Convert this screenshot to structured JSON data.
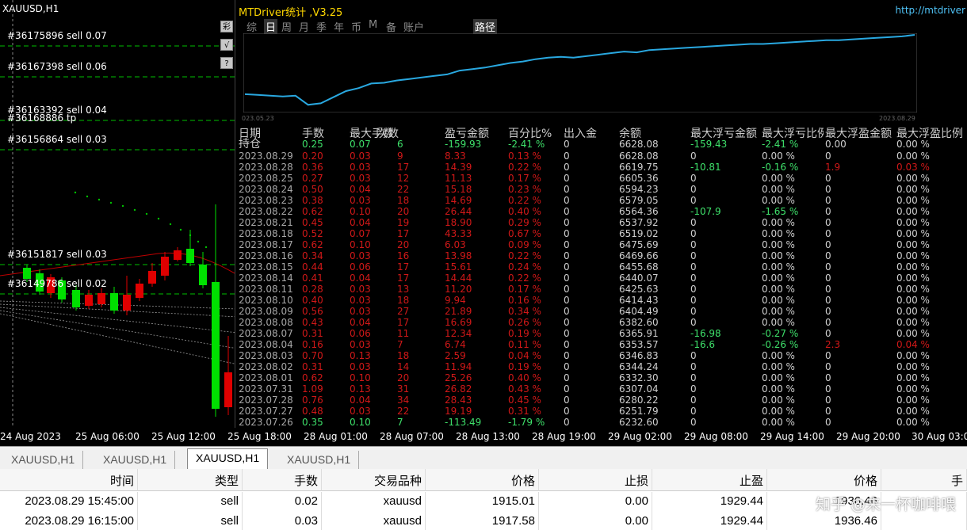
{
  "chart": {
    "symbol": "XAUUSD,H1",
    "orders": [
      {
        "label": "#36175896 sell 0.07"
      },
      {
        "label": "#36167398 sell 0.06"
      },
      {
        "label": "#36163392 sell 0.04"
      },
      {
        "label": "#36168886 tp"
      },
      {
        "label": "#36156864 sell 0.03"
      },
      {
        "label": "#36151817 sell 0.03"
      },
      {
        "label": "#36149786 sell 0.02"
      }
    ],
    "side_buttons": [
      "彩",
      "√",
      "?"
    ],
    "x_ticks": [
      "24 Aug 2023",
      "25 Aug 06:00",
      "25 Aug 12:00",
      "25 Aug 18:00",
      "28 Aug 01:00",
      "28 Aug 07:00",
      "28 Aug 13:00",
      "28 Aug 19:00",
      "29 Aug 02:00",
      "29 Aug 08:00",
      "29 Aug 14:00",
      "29 Aug 20:00",
      "30 Aug 03:00"
    ],
    "colors": {
      "bull": "#00e000",
      "bear": "#e00000",
      "dots": "#00c000",
      "ma": "#c00000"
    }
  },
  "panel": {
    "title": "MTDriver统计 ,V3.25",
    "url": "http://mtdriver",
    "tabs": [
      "综",
      "日",
      "周",
      "月",
      "季",
      "年",
      "币",
      "M",
      "备",
      "账户"
    ],
    "active_tab": "日",
    "route_label": "路径",
    "equity_curve": {
      "start_label": "023.05.23",
      "end_label": "2023.08.29",
      "color": "#29a8e0",
      "values": [
        0.22,
        0.21,
        0.2,
        0.19,
        0.2,
        0.08,
        0.1,
        0.18,
        0.26,
        0.3,
        0.36,
        0.37,
        0.4,
        0.42,
        0.44,
        0.46,
        0.48,
        0.53,
        0.55,
        0.57,
        0.6,
        0.63,
        0.65,
        0.68,
        0.7,
        0.71,
        0.7,
        0.72,
        0.74,
        0.76,
        0.78,
        0.77,
        0.8,
        0.81,
        0.82,
        0.83,
        0.84,
        0.85,
        0.86,
        0.87,
        0.88,
        0.88,
        0.89,
        0.9,
        0.91,
        0.92,
        0.93,
        0.93,
        0.94,
        0.95,
        0.96,
        0.97,
        0.98,
        1.0
      ]
    },
    "headers": [
      "日期",
      "手数",
      "最大手数",
      "次数",
      "盈亏金额",
      "百分比%",
      "出入金",
      "余额",
      "最大浮亏金额",
      "最大浮亏比例",
      "最大浮盈金额",
      "最大浮盈比例"
    ],
    "summary": {
      "label": "持仓",
      "lots": "0.25",
      "max_lots": "0.07",
      "count": "6",
      "pnl": "-159.93",
      "pct": "-2.41 %",
      "flow": "0",
      "balance": "6628.08",
      "max_float_loss": "-159.43",
      "max_float_loss_pct": "-2.41 %",
      "max_float_profit": "0.00",
      "max_float_profit_pct": "0.00 %"
    },
    "rows": [
      {
        "date": "2023.08.29",
        "lots": "0.20",
        "max_lots": "0.03",
        "count": "9",
        "pnl": "8.33",
        "pct": "0.13 %",
        "flow": "0",
        "balance": "6628.08",
        "mfl": "0",
        "mflp": "0.00 %",
        "mfp": "0",
        "mfpp": "0.00 %"
      },
      {
        "date": "2023.08.28",
        "lots": "0.36",
        "max_lots": "0.03",
        "count": "17",
        "pnl": "14.39",
        "pct": "0.22 %",
        "flow": "0",
        "balance": "6619.75",
        "mfl": "-10.81",
        "mflp": "-0.16 %",
        "mfp": "1.9",
        "mfpp": "0.03 %"
      },
      {
        "date": "2023.08.25",
        "lots": "0.27",
        "max_lots": "0.03",
        "count": "12",
        "pnl": "11.13",
        "pct": "0.17 %",
        "flow": "0",
        "balance": "6605.36",
        "mfl": "0",
        "mflp": "0.00 %",
        "mfp": "0",
        "mfpp": "0.00 %"
      },
      {
        "date": "2023.08.24",
        "lots": "0.50",
        "max_lots": "0.04",
        "count": "22",
        "pnl": "15.18",
        "pct": "0.23 %",
        "flow": "0",
        "balance": "6594.23",
        "mfl": "0",
        "mflp": "0.00 %",
        "mfp": "0",
        "mfpp": "0.00 %"
      },
      {
        "date": "2023.08.23",
        "lots": "0.38",
        "max_lots": "0.03",
        "count": "18",
        "pnl": "14.69",
        "pct": "0.22 %",
        "flow": "0",
        "balance": "6579.05",
        "mfl": "0",
        "mflp": "0.00 %",
        "mfp": "0",
        "mfpp": "0.00 %"
      },
      {
        "date": "2023.08.22",
        "lots": "0.62",
        "max_lots": "0.10",
        "count": "20",
        "pnl": "26.44",
        "pct": "0.40 %",
        "flow": "0",
        "balance": "6564.36",
        "mfl": "-107.9",
        "mflp": "-1.65 %",
        "mfp": "0",
        "mfpp": "0.00 %"
      },
      {
        "date": "2023.08.21",
        "lots": "0.45",
        "max_lots": "0.04",
        "count": "19",
        "pnl": "18.90",
        "pct": "0.29 %",
        "flow": "0",
        "balance": "6537.92",
        "mfl": "0",
        "mflp": "0.00 %",
        "mfp": "0",
        "mfpp": "0.00 %"
      },
      {
        "date": "2023.08.18",
        "lots": "0.52",
        "max_lots": "0.07",
        "count": "17",
        "pnl": "43.33",
        "pct": "0.67 %",
        "flow": "0",
        "balance": "6519.02",
        "mfl": "0",
        "mflp": "0.00 %",
        "mfp": "0",
        "mfpp": "0.00 %"
      },
      {
        "date": "2023.08.17",
        "lots": "0.62",
        "max_lots": "0.10",
        "count": "20",
        "pnl": "6.03",
        "pct": "0.09 %",
        "flow": "0",
        "balance": "6475.69",
        "mfl": "0",
        "mflp": "0.00 %",
        "mfp": "0",
        "mfpp": "0.00 %"
      },
      {
        "date": "2023.08.16",
        "lots": "0.34",
        "max_lots": "0.03",
        "count": "16",
        "pnl": "13.98",
        "pct": "0.22 %",
        "flow": "0",
        "balance": "6469.66",
        "mfl": "0",
        "mflp": "0.00 %",
        "mfp": "0",
        "mfpp": "0.00 %"
      },
      {
        "date": "2023.08.15",
        "lots": "0.44",
        "max_lots": "0.06",
        "count": "17",
        "pnl": "15.61",
        "pct": "0.24 %",
        "flow": "0",
        "balance": "6455.68",
        "mfl": "0",
        "mflp": "0.00 %",
        "mfp": "0",
        "mfpp": "0.00 %"
      },
      {
        "date": "2023.08.14",
        "lots": "0.41",
        "max_lots": "0.04",
        "count": "17",
        "pnl": "14.44",
        "pct": "0.22 %",
        "flow": "0",
        "balance": "6440.07",
        "mfl": "0",
        "mflp": "0.00 %",
        "mfp": "0",
        "mfpp": "0.00 %"
      },
      {
        "date": "2023.08.11",
        "lots": "0.28",
        "max_lots": "0.03",
        "count": "13",
        "pnl": "11.20",
        "pct": "0.17 %",
        "flow": "0",
        "balance": "6425.63",
        "mfl": "0",
        "mflp": "0.00 %",
        "mfp": "0",
        "mfpp": "0.00 %"
      },
      {
        "date": "2023.08.10",
        "lots": "0.40",
        "max_lots": "0.03",
        "count": "18",
        "pnl": "9.94",
        "pct": "0.16 %",
        "flow": "0",
        "balance": "6414.43",
        "mfl": "0",
        "mflp": "0.00 %",
        "mfp": "0",
        "mfpp": "0.00 %"
      },
      {
        "date": "2023.08.09",
        "lots": "0.56",
        "max_lots": "0.03",
        "count": "27",
        "pnl": "21.89",
        "pct": "0.34 %",
        "flow": "0",
        "balance": "6404.49",
        "mfl": "0",
        "mflp": "0.00 %",
        "mfp": "0",
        "mfpp": "0.00 %"
      },
      {
        "date": "2023.08.08",
        "lots": "0.43",
        "max_lots": "0.04",
        "count": "17",
        "pnl": "16.69",
        "pct": "0.26 %",
        "flow": "0",
        "balance": "6382.60",
        "mfl": "0",
        "mflp": "0.00 %",
        "mfp": "0",
        "mfpp": "0.00 %"
      },
      {
        "date": "2023.08.07",
        "lots": "0.31",
        "max_lots": "0.06",
        "count": "11",
        "pnl": "12.34",
        "pct": "0.19 %",
        "flow": "0",
        "balance": "6365.91",
        "mfl": "-16.98",
        "mflp": "-0.27 %",
        "mfp": "0",
        "mfpp": "0.00 %"
      },
      {
        "date": "2023.08.04",
        "lots": "0.16",
        "max_lots": "0.03",
        "count": "7",
        "pnl": "6.74",
        "pct": "0.11 %",
        "flow": "0",
        "balance": "6353.57",
        "mfl": "-16.6",
        "mflp": "-0.26 %",
        "mfp": "2.3",
        "mfpp": "0.04 %"
      },
      {
        "date": "2023.08.03",
        "lots": "0.70",
        "max_lots": "0.13",
        "count": "18",
        "pnl": "2.59",
        "pct": "0.04 %",
        "flow": "0",
        "balance": "6346.83",
        "mfl": "0",
        "mflp": "0.00 %",
        "mfp": "0",
        "mfpp": "0.00 %"
      },
      {
        "date": "2023.08.02",
        "lots": "0.31",
        "max_lots": "0.03",
        "count": "14",
        "pnl": "11.94",
        "pct": "0.19 %",
        "flow": "0",
        "balance": "6344.24",
        "mfl": "0",
        "mflp": "0.00 %",
        "mfp": "0",
        "mfpp": "0.00 %"
      },
      {
        "date": "2023.08.01",
        "lots": "0.62",
        "max_lots": "0.10",
        "count": "20",
        "pnl": "25.26",
        "pct": "0.40 %",
        "flow": "0",
        "balance": "6332.30",
        "mfl": "0",
        "mflp": "0.00 %",
        "mfp": "0",
        "mfpp": "0.00 %"
      },
      {
        "date": "2023.07.31",
        "lots": "1.09",
        "max_lots": "0.13",
        "count": "31",
        "pnl": "26.82",
        "pct": "0.43 %",
        "flow": "0",
        "balance": "6307.04",
        "mfl": "0",
        "mflp": "0.00 %",
        "mfp": "0",
        "mfpp": "0.00 %"
      },
      {
        "date": "2023.07.28",
        "lots": "0.76",
        "max_lots": "0.04",
        "count": "34",
        "pnl": "28.43",
        "pct": "0.45 %",
        "flow": "0",
        "balance": "6280.22",
        "mfl": "0",
        "mflp": "0.00 %",
        "mfp": "0",
        "mfpp": "0.00 %"
      },
      {
        "date": "2023.07.27",
        "lots": "0.48",
        "max_lots": "0.03",
        "count": "22",
        "pnl": "19.19",
        "pct": "0.31 %",
        "flow": "0",
        "balance": "6251.79",
        "mfl": "0",
        "mflp": "0.00 %",
        "mfp": "0",
        "mfpp": "0.00 %"
      },
      {
        "date": "2023.07.26",
        "lots": "0.35",
        "max_lots": "0.10",
        "count": "7",
        "pnl": "-113.49",
        "pct": "-1.79 %",
        "flow": "0",
        "balance": "6232.60",
        "mfl": "0",
        "mflp": "0.00 %",
        "mfp": "0",
        "mfpp": "0.00 %"
      }
    ]
  },
  "file_tabs": [
    "XAUUSD,H1",
    "XAUUSD,H1",
    "XAUUSD,H1",
    "XAUUSD,H1"
  ],
  "active_file_tab": 2,
  "orders_table": {
    "headers": [
      "时间",
      "类型",
      "手数",
      "交易品种",
      "价格",
      "止损",
      "止盈",
      "价格",
      "手"
    ],
    "rows": [
      [
        "2023.08.29 15:45:00",
        "sell",
        "0.02",
        "xauusd",
        "1915.01",
        "0.00",
        "1929.44",
        "1936.46",
        ""
      ],
      [
        "2023.08.29 16:15:00",
        "sell",
        "0.03",
        "xauusd",
        "1917.58",
        "0.00",
        "1929.44",
        "1936.46",
        ""
      ]
    ]
  },
  "watermark": "知乎 @来一杯咖啡喂"
}
